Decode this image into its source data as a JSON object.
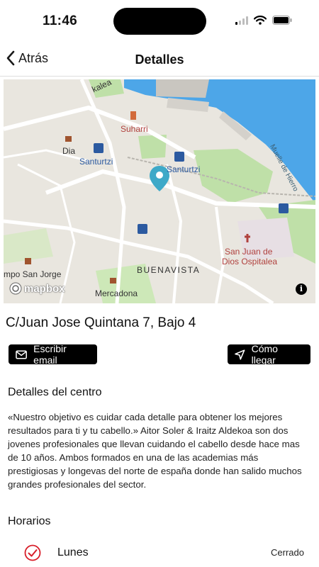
{
  "status_bar": {
    "time": "11:46"
  },
  "nav": {
    "back_label": "Atrás",
    "title": "Detalles"
  },
  "map": {
    "labels": {
      "kalea": "kalea",
      "suharri": "Suharri",
      "dia": "Dia",
      "santurtzi_1": "Santurtzi",
      "santurtzi_2": "Santurtzi",
      "muelle": "Muelle de Hierro",
      "san_juan_1": "San Juan de",
      "san_juan_2": "Dios Ospitalea",
      "campo": "mpo San Jorge",
      "buenavista": "BUENAVISTA",
      "mercadona": "Mercadona"
    },
    "attribution": "mapbox",
    "info": "i",
    "colors": {
      "water": "#4da6e8",
      "park": "#bfe0a8",
      "land": "#e9e6df",
      "pin": "#3ea9c8"
    }
  },
  "address": "C/Juan Jose Quintana 7, Bajo 4",
  "actions": {
    "email": "Escribir email",
    "directions": "Cómo llegar"
  },
  "details": {
    "title": "Detalles del centro",
    "text": "«Nuestro objetivo es cuidar cada detalle para obtener los mejores resultados para ti y tu cabello.»  Aitor Soler & Iraitz Aldekoa son dos jovenes profesionales que llevan cuidando el cabello desde hace mas de 10 años.  Ambos formados en una de las academias más prestigiosas y longevas del norte de españa donde han salido muchos grandes profesionales del sector."
  },
  "hours": {
    "title": "Horarios",
    "rows": [
      {
        "day": "Lunes",
        "value": "Cerrado"
      }
    ]
  }
}
